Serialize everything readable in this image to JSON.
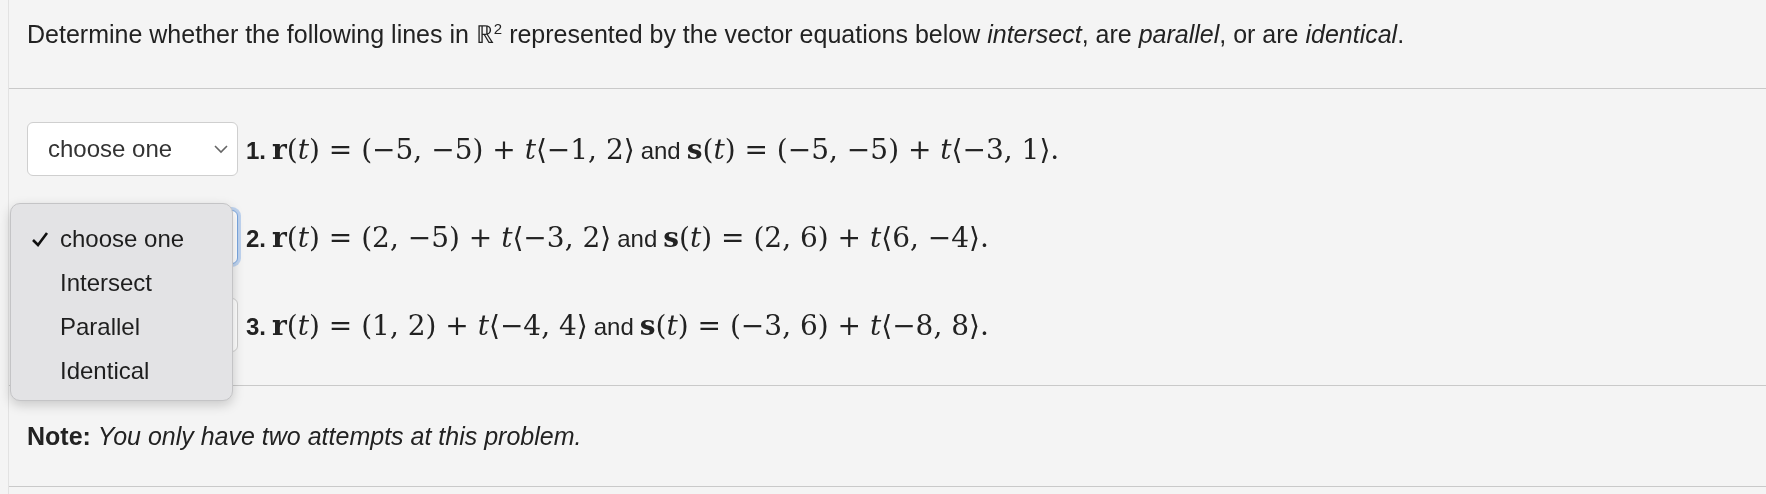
{
  "instructions": "Determine whether the following lines in ℝ$^{2}$ represented by the vector equations below *intersect*, are *parallel*, or are *identical*.",
  "problems": [
    {
      "number": "1.",
      "r_equation": "**r**(*t*) = (−5, −5) + *t*⟨−1, 2⟩",
      "joiner": "and",
      "s_equation": "**s**(*t*) = (−5, −5) + *t*⟨−3, 1⟩.",
      "select": {
        "value": "choose one",
        "open": false,
        "focused": false
      }
    },
    {
      "number": "2.",
      "r_equation": "**r**(*t*) = (2, −5) + *t*⟨−3, 2⟩",
      "joiner": "and",
      "s_equation": "**s**(*t*) = (2, 6) + *t*⟨6, −4⟩.",
      "select": {
        "open": true,
        "focused": true,
        "options": [
          {
            "label": "choose one",
            "selected": true
          },
          {
            "label": "Intersect",
            "selected": false
          },
          {
            "label": "Parallel",
            "selected": false
          },
          {
            "label": "Identical",
            "selected": false
          }
        ]
      }
    },
    {
      "number": "3.",
      "r_equation": "**r**(*t*) = (1, 2) + *t*⟨−4, 4⟩",
      "joiner": "and",
      "s_equation": "**s**(*t*) = (−3, 6) + *t*⟨−8, 8⟩.",
      "select": {
        "open": false,
        "focused": false
      }
    }
  ],
  "note": "**Note:** *You only have two attempts at this problem.*"
}
